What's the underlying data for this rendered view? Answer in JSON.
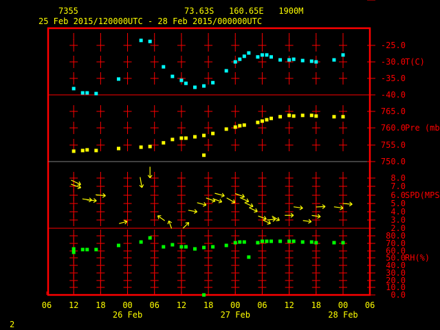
{
  "header": {
    "station": "7355",
    "location": "73.63S   160.65E   1900M",
    "period": "25 Feb 2015/120000UTC - 28 Feb 2015/000000UTC"
  },
  "footer": {
    "page_number": "2"
  },
  "colors": {
    "axis": "#ff0000",
    "text": "#ffff00",
    "temperature": "#00ffff",
    "pressure": "#ffff00",
    "wind": "#ffff00",
    "rh": "#00ff00",
    "divider_grey": "#808080"
  },
  "chart_data": {
    "type": "scatter",
    "title": "7355 73.63S 160.65E 1900M",
    "x_units": "hours since 25 Feb 2015 06 UTC",
    "xlim": [
      0,
      72
    ],
    "x_ticks": [
      "06",
      "12",
      "18",
      "00",
      "06",
      "12",
      "18",
      "00",
      "06",
      "12",
      "18",
      "00",
      "06"
    ],
    "date_labels": [
      {
        "label": "26 Feb",
        "hour": 18
      },
      {
        "label": "27 Feb",
        "hour": 42
      },
      {
        "label": "28 Feb",
        "hour": 66
      }
    ],
    "panels": [
      {
        "name": "temperature",
        "label": "T(C)",
        "ylim": [
          -40,
          -25
        ],
        "ticks": [
          "-25.0",
          "-30.0",
          "-35.0",
          "-40.0"
        ],
        "points": [
          [
            6,
            -38.1
          ],
          [
            8,
            -39.4
          ],
          [
            9,
            -39.4
          ],
          [
            11,
            -39.6
          ],
          [
            16,
            -35.2
          ],
          [
            21,
            -23.5
          ],
          [
            23,
            -23.8
          ],
          [
            26,
            -31.5
          ],
          [
            28,
            -34.4
          ],
          [
            30,
            -35.6
          ],
          [
            31,
            -36.5
          ],
          [
            33,
            -37.7
          ],
          [
            35,
            -37.3
          ],
          [
            37,
            -36.3
          ],
          [
            40,
            -32.7
          ],
          [
            42,
            -30.0
          ],
          [
            43,
            -29.2
          ],
          [
            44,
            -28.3
          ],
          [
            45,
            -27.3
          ],
          [
            47,
            -28.5
          ],
          [
            48,
            -27.9
          ],
          [
            49,
            -27.9
          ],
          [
            50,
            -28.5
          ],
          [
            52,
            -29.4
          ],
          [
            54,
            -29.4
          ],
          [
            55,
            -29.2
          ],
          [
            57,
            -29.6
          ],
          [
            59,
            -29.8
          ],
          [
            60,
            -30.0
          ],
          [
            64,
            -29.4
          ],
          [
            66,
            -27.9
          ]
        ]
      },
      {
        "name": "pressure",
        "label": "Pre (mb)",
        "ylim": [
          750,
          765
        ],
        "ticks": [
          "765.0",
          "760.0",
          "755.0",
          "750.0"
        ],
        "points": [
          [
            6,
            753.1
          ],
          [
            8,
            753.3
          ],
          [
            9,
            753.5
          ],
          [
            11,
            753.3
          ],
          [
            16,
            753.9
          ],
          [
            21,
            754.3
          ],
          [
            23,
            754.5
          ],
          [
            26,
            755.6
          ],
          [
            28,
            756.6
          ],
          [
            30,
            757.0
          ],
          [
            31,
            757.0
          ],
          [
            33,
            757.4
          ],
          [
            35,
            757.8
          ],
          [
            35,
            751.9
          ],
          [
            37,
            758.4
          ],
          [
            40,
            759.7
          ],
          [
            42,
            760.3
          ],
          [
            43,
            760.7
          ],
          [
            44,
            760.9
          ],
          [
            47,
            761.7
          ],
          [
            48,
            762.1
          ],
          [
            49,
            762.5
          ],
          [
            50,
            762.9
          ],
          [
            52,
            763.4
          ],
          [
            54,
            763.8
          ],
          [
            55,
            763.6
          ],
          [
            57,
            763.8
          ],
          [
            59,
            763.8
          ],
          [
            60,
            763.6
          ],
          [
            64,
            763.4
          ],
          [
            66,
            763.4
          ]
        ]
      },
      {
        "name": "wind_speed",
        "label": "SPD(MPS)",
        "ylim": [
          1,
          8
        ],
        "ticks": [
          "8.0",
          "7.0",
          "6.0",
          "5.0",
          "4.0",
          "3.0",
          "2.0",
          "1.0"
        ],
        "wind_note": "[hour, speed m/s, arrow direction in degrees clockwise from east]",
        "points": [
          [
            6.5,
            7.4,
            25
          ],
          [
            6.5,
            6.9,
            20
          ],
          [
            9,
            5.0,
            8
          ],
          [
            10,
            4.9,
            5
          ],
          [
            12,
            5.6,
            5
          ],
          [
            17,
            1.8,
            -15
          ],
          [
            21,
            7.4,
            80
          ],
          [
            23,
            8.8,
            90
          ],
          [
            25.5,
            2.4,
            215
          ],
          [
            27.5,
            1.5,
            250
          ],
          [
            31,
            1.4,
            -45
          ],
          [
            32.5,
            3.4,
            10
          ],
          [
            34.5,
            4.4,
            15
          ],
          [
            36.5,
            5.0,
            20
          ],
          [
            38,
            4.9,
            20
          ],
          [
            38.5,
            5.7,
            15
          ],
          [
            41,
            4.9,
            30
          ],
          [
            43,
            5.6,
            20
          ],
          [
            44,
            5.0,
            25
          ],
          [
            45,
            4.3,
            25
          ],
          [
            46,
            3.6,
            25
          ],
          [
            48,
            2.5,
            20
          ],
          [
            49,
            1.9,
            25
          ],
          [
            50,
            2.2,
            -5
          ],
          [
            51,
            2.4,
            30
          ],
          [
            54,
            2.8,
            0
          ],
          [
            56,
            3.9,
            8
          ],
          [
            58,
            2.0,
            8
          ],
          [
            60,
            2.7,
            8
          ],
          [
            61,
            4.0,
            -3
          ],
          [
            65,
            3.9,
            8
          ],
          [
            67,
            4.4,
            5
          ]
        ]
      },
      {
        "name": "relative_humidity",
        "label": "RH(%)",
        "ylim": [
          0,
          80
        ],
        "ticks": [
          "80.0",
          "70.0",
          "60.0",
          "50.0",
          "40.0",
          "30.0",
          "20.0",
          "10.0",
          "0.0"
        ],
        "points": [
          [
            6,
            62.3
          ],
          [
            6,
            57.7
          ],
          [
            8,
            61.4
          ],
          [
            9,
            61.4
          ],
          [
            11,
            61.4
          ],
          [
            16,
            67.0
          ],
          [
            21,
            71.6
          ],
          [
            23,
            77.2
          ],
          [
            26,
            65.1
          ],
          [
            28,
            67.9
          ],
          [
            30,
            65.1
          ],
          [
            31,
            65.1
          ],
          [
            33,
            62.3
          ],
          [
            35,
            64.2
          ],
          [
            35,
            0
          ],
          [
            37,
            65.1
          ],
          [
            40,
            67.0
          ],
          [
            42,
            70.7
          ],
          [
            43,
            71.6
          ],
          [
            44,
            71.6
          ],
          [
            45,
            51.2
          ],
          [
            47,
            70.7
          ],
          [
            48,
            72.6
          ],
          [
            49,
            72.6
          ],
          [
            50,
            72.6
          ],
          [
            52,
            72.6
          ],
          [
            54,
            72.6
          ],
          [
            55,
            72.6
          ],
          [
            57,
            71.6
          ],
          [
            59,
            71.6
          ],
          [
            60,
            70.7
          ],
          [
            64,
            70.7
          ],
          [
            66,
            70.7
          ]
        ]
      }
    ]
  }
}
